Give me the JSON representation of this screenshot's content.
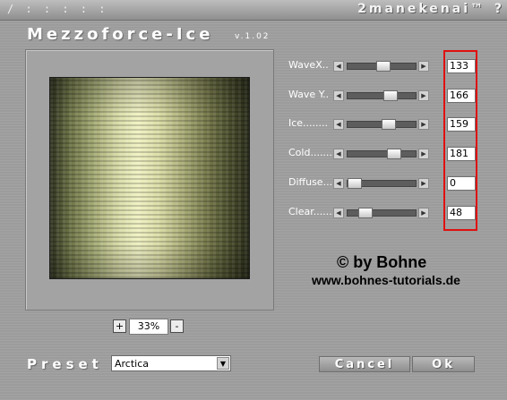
{
  "titlebar": {
    "dots": "/ : : : : :",
    "brand": "2manekenai™",
    "help_label": "?"
  },
  "filter": {
    "title": "Mezzoforce-Ice",
    "version": "v.1.02"
  },
  "zoom": {
    "minus_label": "-",
    "plus_label": "+",
    "value": "33%"
  },
  "parameters": [
    {
      "label": "WaveX..",
      "value": "133",
      "level": 0.52
    },
    {
      "label": "Wave Y..",
      "value": "166",
      "level": 0.65
    },
    {
      "label": "Ice........",
      "value": "159",
      "level": 0.62
    },
    {
      "label": "Cold........",
      "value": "181",
      "level": 0.71
    },
    {
      "label": "Diffuse.....",
      "value": "0",
      "level": 0.0
    },
    {
      "label": "Clear........",
      "value": "48",
      "level": 0.19
    }
  ],
  "watermark": {
    "copyright": "© by Bohne",
    "website": "www.bohnes-tutorials.de"
  },
  "preset": {
    "label": "Preset",
    "selected": "Arctica"
  },
  "buttons": {
    "cancel": "Cancel",
    "ok": "Ok"
  },
  "colors": {
    "highlight": "#e01010",
    "panel": "#9c9c9c"
  }
}
